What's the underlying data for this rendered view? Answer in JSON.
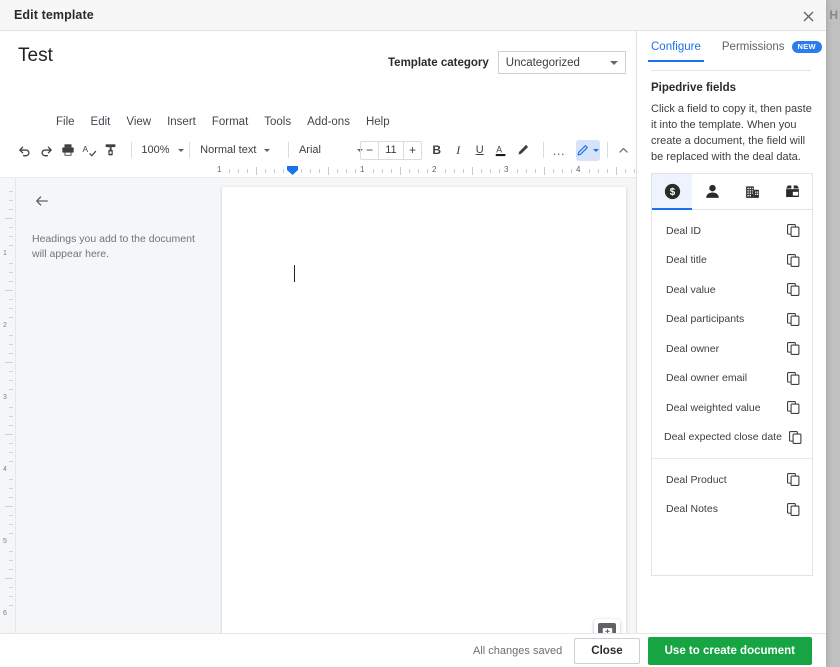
{
  "window": {
    "title": "Edit template",
    "close_icon": "close-icon",
    "background_letter": "H"
  },
  "document": {
    "title": "Test",
    "category_label": "Template category",
    "category_value": "Uncategorized",
    "category_options": [
      "Uncategorized"
    ],
    "menu": [
      "File",
      "Edit",
      "View",
      "Insert",
      "Format",
      "Tools",
      "Add-ons",
      "Help"
    ],
    "toolbar": {
      "undo_icon": "undo-icon",
      "redo_icon": "redo-icon",
      "print_icon": "print-icon",
      "spellcheck_icon": "spellcheck-icon",
      "paint_format_icon": "paint-format-icon",
      "zoom": "100%",
      "style": "Normal text",
      "font": "Arial",
      "font_size": "11",
      "decrease_label": "−",
      "increase_label": "+",
      "bold_label": "B",
      "italic_label": "I",
      "underline_label": "U",
      "text_color_label": "A",
      "highlight_icon": "highlight-pen-icon",
      "more_label": "…",
      "edit_mode_icon": "pencil-icon",
      "collapse_icon": "chevron-up-icon"
    },
    "ruler": {
      "numbers": [
        "1",
        "1",
        "2",
        "3",
        "4"
      ],
      "indent_marker": "indent-marker"
    },
    "outline": {
      "back_icon": "back-arrow-icon",
      "hint": "Headings you add to the document will appear here."
    },
    "comment_button_icon": "add-comment-icon"
  },
  "panel": {
    "tabs": [
      {
        "label": "Configure",
        "active": true
      },
      {
        "label": "Permissions",
        "active": false,
        "badge": "NEW"
      }
    ],
    "heading": "Pipedrive fields",
    "description": "Click a field to copy it, then paste it into the template. When you create a document, the field will be replaced with the deal data.",
    "entity_tabs": [
      {
        "icon": "deal-dollar-icon",
        "active": true
      },
      {
        "icon": "person-icon",
        "active": false
      },
      {
        "icon": "organization-building-icon",
        "active": false
      },
      {
        "icon": "product-box-icon",
        "active": false
      }
    ],
    "fields_group_1": [
      {
        "label": "Deal ID",
        "copy_icon": "copy-icon"
      },
      {
        "label": "Deal title",
        "copy_icon": "copy-icon"
      },
      {
        "label": "Deal value",
        "copy_icon": "copy-icon"
      },
      {
        "label": "Deal participants",
        "copy_icon": "copy-icon"
      },
      {
        "label": "Deal owner",
        "copy_icon": "copy-icon"
      },
      {
        "label": "Deal owner email",
        "copy_icon": "copy-icon"
      },
      {
        "label": "Deal weighted value",
        "copy_icon": "copy-icon"
      },
      {
        "label": "Deal expected close date",
        "copy_icon": "copy-icon"
      }
    ],
    "fields_group_2": [
      {
        "label": "Deal Product",
        "copy_icon": "copy-icon"
      },
      {
        "label": "Deal Notes",
        "copy_icon": "copy-icon"
      }
    ]
  },
  "footer": {
    "status": "All changes saved",
    "close_label": "Close",
    "primary_label": "Use to create document"
  },
  "colors": {
    "accent_blue": "#1a73e8",
    "badge_blue": "#2b7de9",
    "primary_green": "#17a543"
  }
}
